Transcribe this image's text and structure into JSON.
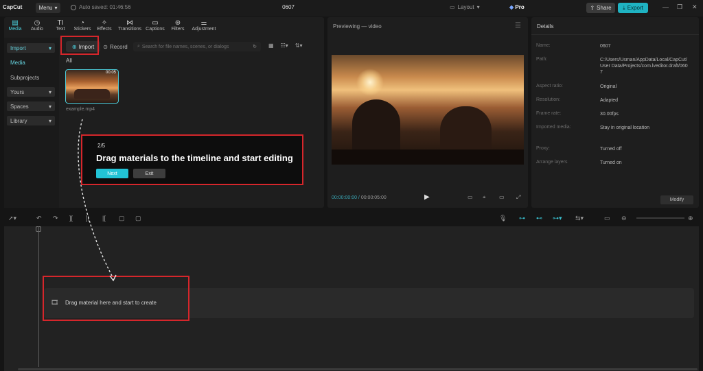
{
  "app": {
    "logo": "CapCut",
    "menu": "Menu",
    "autosave": "Auto saved: 01:46:56",
    "project_title": "0607",
    "layout": "Layout",
    "pro": "Pro",
    "share": "Share",
    "export": "Export"
  },
  "media": {
    "tools": [
      {
        "label": "Media",
        "icon": "media-icon"
      },
      {
        "label": "Audio",
        "icon": "audio-icon"
      },
      {
        "label": "Text",
        "icon": "text-icon"
      },
      {
        "label": "Stickers",
        "icon": "stickers-icon"
      },
      {
        "label": "Effects",
        "icon": "effects-icon"
      },
      {
        "label": "Transitions",
        "icon": "transitions-icon"
      },
      {
        "label": "Captions",
        "icon": "captions-icon"
      },
      {
        "label": "Filters",
        "icon": "filters-icon"
      },
      {
        "label": "Adjustment",
        "icon": "adjustment-icon"
      }
    ],
    "sidebar": [
      "Import",
      "Media",
      "Subprojects",
      "Yours",
      "Spaces",
      "Library"
    ],
    "import": "Import",
    "record": "Record",
    "search_placeholder": "Search for file names, scenes, or dialogs",
    "all": "All",
    "file_name": "example.mp4",
    "file_duration": "00:05"
  },
  "tutorial": {
    "step": "2/5",
    "title": "Drag materials to the timeline and start editing",
    "next": "Next",
    "exit": "Exit"
  },
  "player": {
    "title": "Previewing — video",
    "current_time": "00:00:00:00",
    "total_time": "00:00:05:00"
  },
  "details": {
    "title": "Details",
    "rows": [
      {
        "key": "Name:",
        "value": "0607"
      },
      {
        "key": "Path:",
        "value": "C:/Users/Usman/AppData/Local/CapCut/User Data/Projects/com.lveditor.draft/0607"
      },
      {
        "key": "Aspect ratio:",
        "value": "Original"
      },
      {
        "key": "Resolution:",
        "value": "Adapted"
      },
      {
        "key": "Frame rate:",
        "value": "30.00fps"
      },
      {
        "key": "Imported media:",
        "value": "Stay in original location"
      },
      {
        "key": "Proxy:",
        "value": "Turned off"
      },
      {
        "key": "Arrange layers",
        "value": "Turned on"
      }
    ],
    "modify": "Modify"
  },
  "timeline": {
    "drop_hint": "Drag material here and start to create"
  },
  "colors": {
    "accent": "#1fb3c2",
    "highlight": "#d6262b"
  }
}
